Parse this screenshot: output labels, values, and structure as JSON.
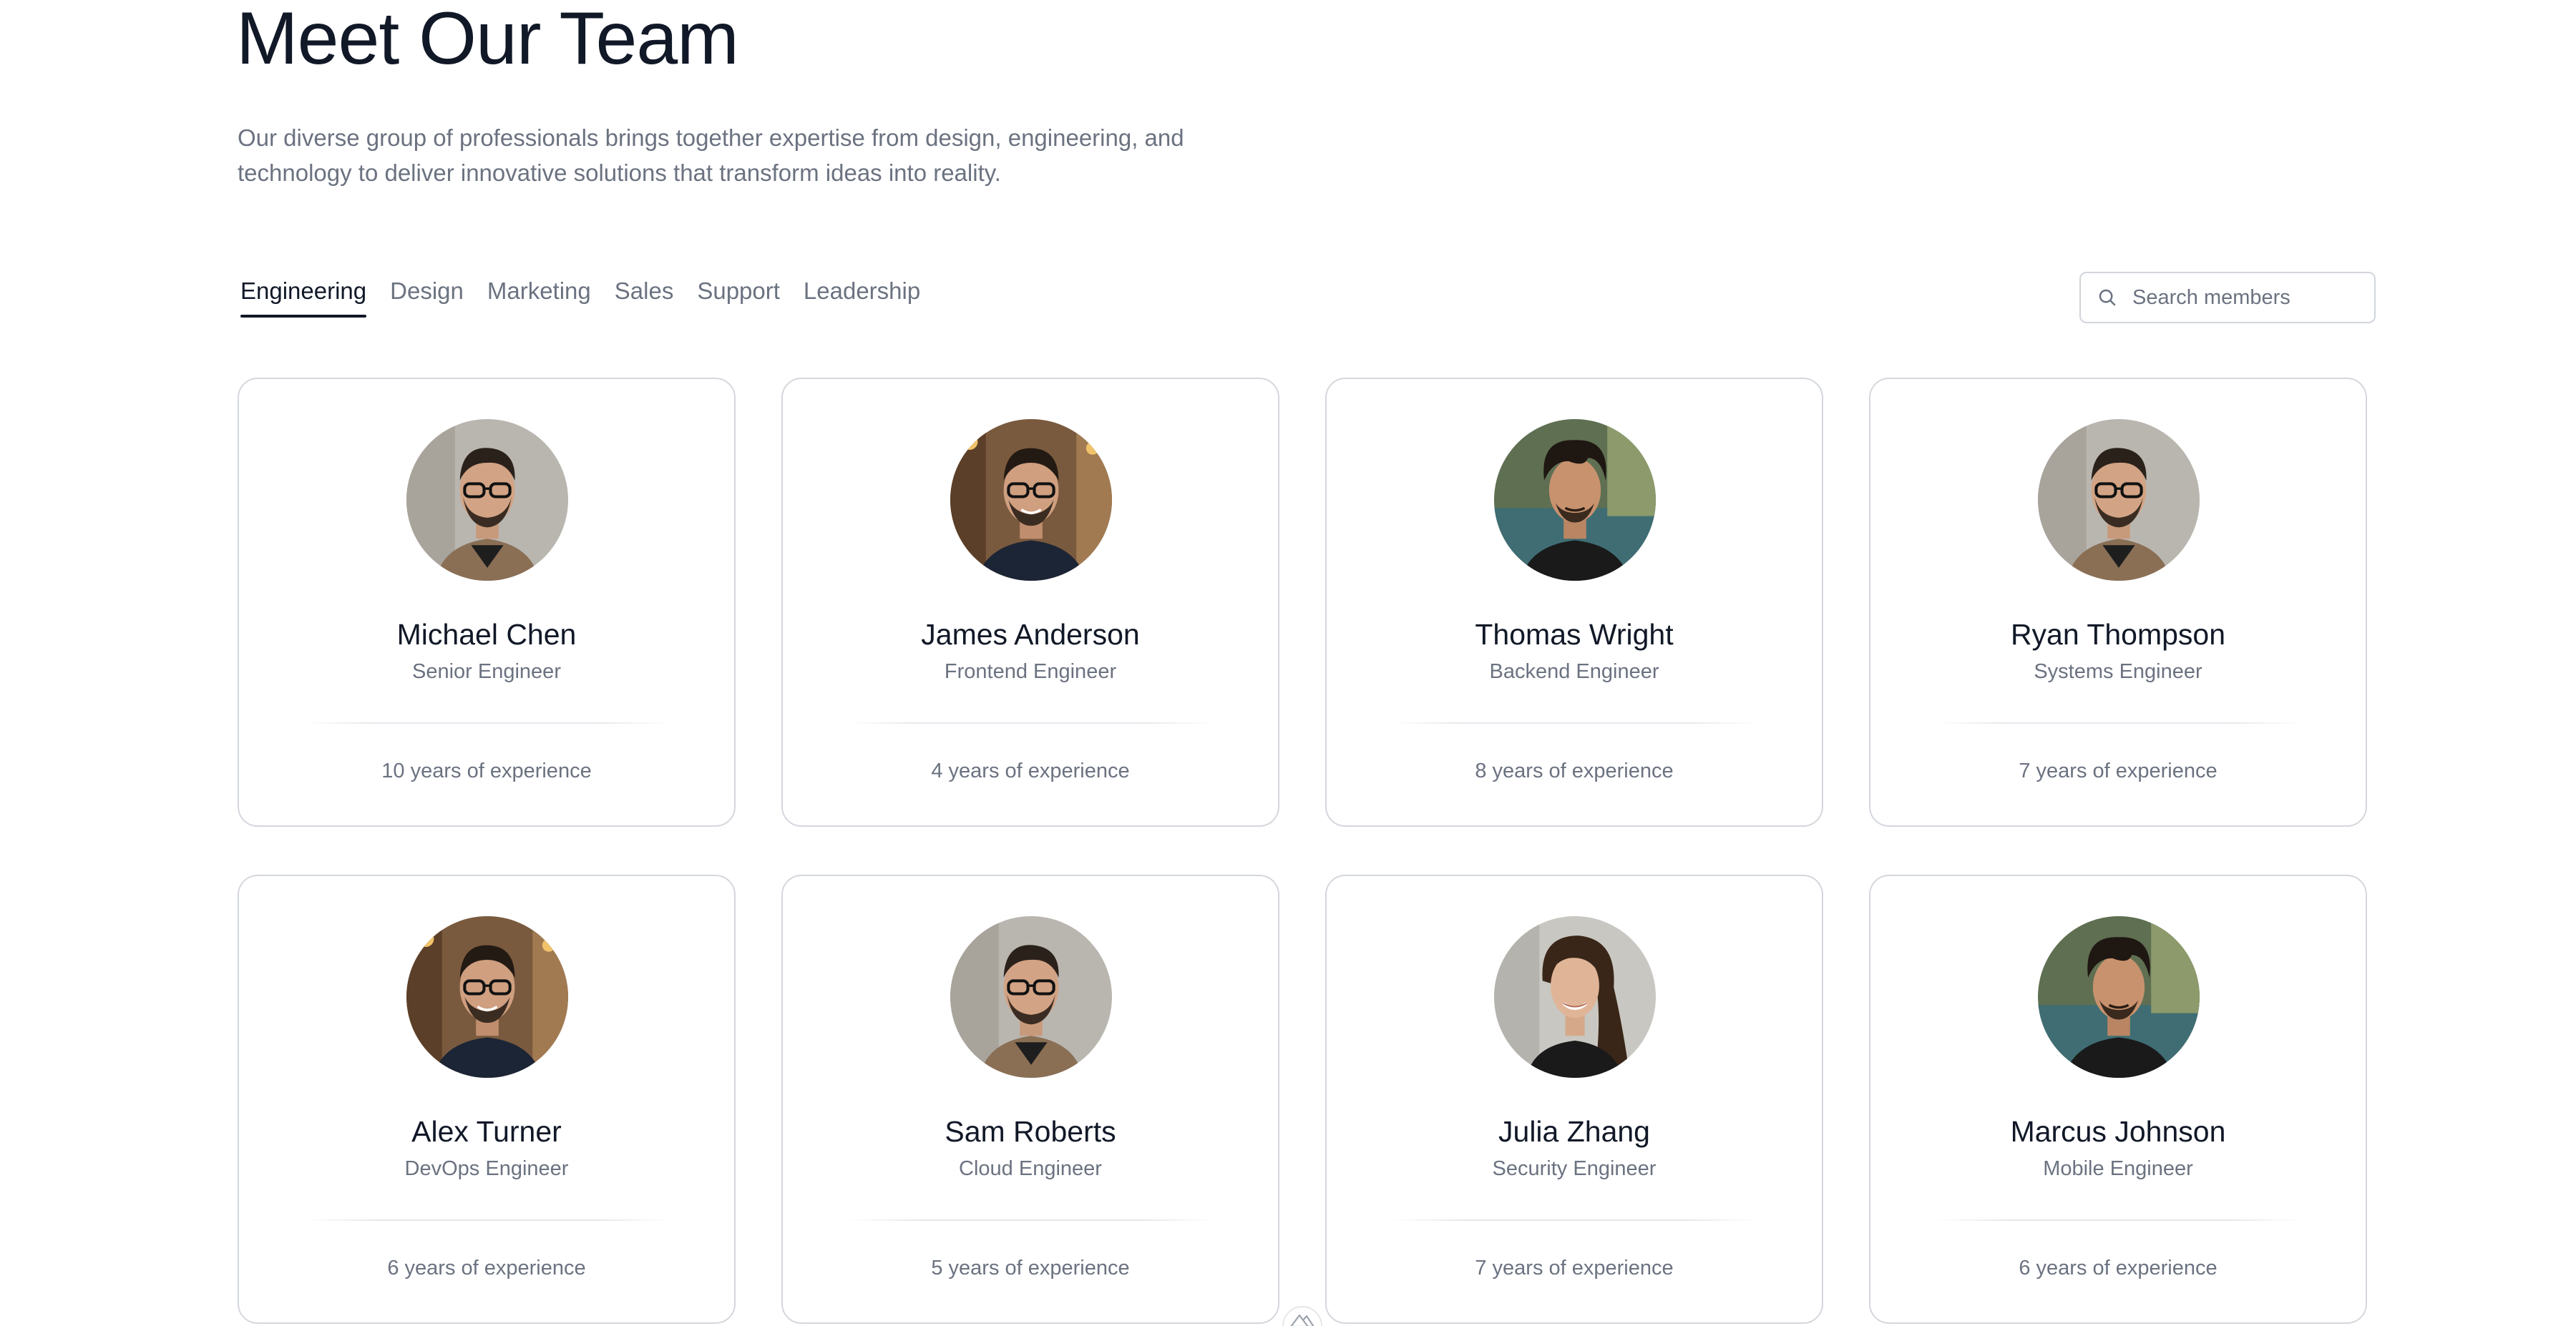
{
  "header": {
    "title": "Meet Our Team",
    "subtitle": "Our diverse group of professionals brings together expertise from design, engineering, and technology to deliver innovative solutions that transform ideas into reality."
  },
  "tabs": [
    {
      "label": "Engineering",
      "active": true
    },
    {
      "label": "Design",
      "active": false
    },
    {
      "label": "Marketing",
      "active": false
    },
    {
      "label": "Sales",
      "active": false
    },
    {
      "label": "Support",
      "active": false
    },
    {
      "label": "Leadership",
      "active": false
    }
  ],
  "search": {
    "placeholder": "Search members",
    "value": "",
    "icon": "search-icon"
  },
  "members": [
    {
      "name": "Michael Chen",
      "role": "Senior Engineer",
      "experience": "10 years of experience",
      "photo": "bearded-man-glasses"
    },
    {
      "name": "James Anderson",
      "role": "Frontend Engineer",
      "experience": "4 years of experience",
      "photo": "smiling-man-glasses"
    },
    {
      "name": "Thomas Wright",
      "role": "Backend Engineer",
      "experience": "8 years of experience",
      "photo": "man-wavy-hair"
    },
    {
      "name": "Ryan Thompson",
      "role": "Systems Engineer",
      "experience": "7 years of experience",
      "photo": "bearded-man-glasses"
    },
    {
      "name": "Alex Turner",
      "role": "DevOps Engineer",
      "experience": "6 years of experience",
      "photo": "smiling-man-glasses"
    },
    {
      "name": "Sam Roberts",
      "role": "Cloud Engineer",
      "experience": "5 years of experience",
      "photo": "bearded-man-glasses"
    },
    {
      "name": "Julia Zhang",
      "role": "Security Engineer",
      "experience": "7 years of experience",
      "photo": "woman-long-hair"
    },
    {
      "name": "Marcus Johnson",
      "role": "Mobile Engineer",
      "experience": "6 years of experience",
      "photo": "man-wavy-hair"
    }
  ],
  "badge": {
    "icon": "mountain-logo-icon"
  },
  "colors": {
    "text_primary": "#111827",
    "text_muted": "#6b7280",
    "border": "#d4d7dc"
  }
}
